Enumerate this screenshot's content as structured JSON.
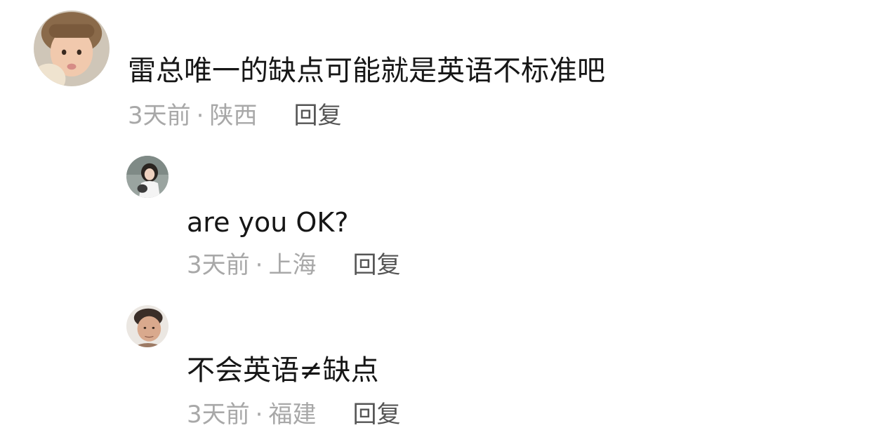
{
  "comments": [
    {
      "avatar_icon": "child-avatar-icon",
      "text": "雷总唯一的缺点可能就是英语不标准吧",
      "time": "3天前",
      "separator": "·",
      "location": "陕西",
      "reply_label": "回复"
    },
    {
      "avatar_icon": "girl-avatar-icon",
      "text": "are you OK?",
      "time": "3天前",
      "separator": "·",
      "location": "上海",
      "reply_label": "回复"
    },
    {
      "avatar_icon": "man-avatar-icon",
      "text": "不会英语≠缺点",
      "time": "3天前",
      "separator": "·",
      "location": "福建",
      "reply_label": "回复"
    }
  ],
  "colors": {
    "text": "#161616",
    "meta": "#a8a8a8",
    "reply": "#555555",
    "background": "#ffffff"
  }
}
